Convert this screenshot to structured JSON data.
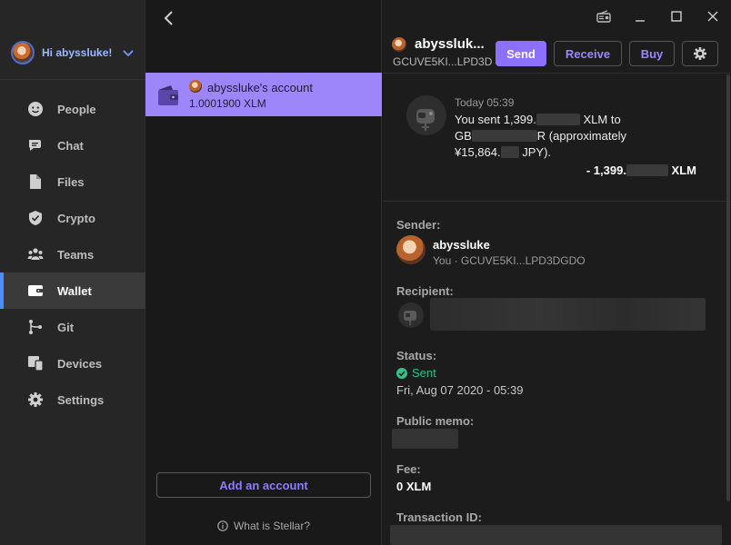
{
  "nav": {
    "greeting": "Hi abyssluke!",
    "items": [
      {
        "label": "People",
        "icon": "people-icon"
      },
      {
        "label": "Chat",
        "icon": "chat-icon"
      },
      {
        "label": "Files",
        "icon": "files-icon"
      },
      {
        "label": "Crypto",
        "icon": "crypto-shield-icon"
      },
      {
        "label": "Teams",
        "icon": "teams-icon"
      },
      {
        "label": "Wallet",
        "icon": "wallet-icon",
        "active": true
      },
      {
        "label": "Git",
        "icon": "git-icon"
      },
      {
        "label": "Devices",
        "icon": "devices-icon"
      },
      {
        "label": "Settings",
        "icon": "gear-icon"
      }
    ]
  },
  "accounts": {
    "selected": {
      "name": "abyssluke's account",
      "balance": "1.0001900 XLM"
    },
    "add_label": "Add an account",
    "help_label": "What is Stellar?"
  },
  "header": {
    "name": "abyssluk...",
    "address": "GCUVE5KI...LPD3D",
    "send_label": "Send",
    "receive_label": "Receive",
    "buy_label": "Buy"
  },
  "transaction": {
    "time": "Today 05:39",
    "desc_part1": "You sent 1,399.",
    "desc_part2": " XLM to",
    "desc_part3": "GB",
    "desc_part4": "R (approximately",
    "desc_part5": "¥15,864.",
    "desc_part6": " JPY).",
    "amount_prefix": "- 1,399.",
    "amount_suffix": " XLM"
  },
  "details": {
    "sender_label": "Sender:",
    "sender_name": "abyssluke",
    "sender_sub": "You · GCUVE5KI...LPD3DGDO",
    "recipient_label": "Recipient:",
    "status_label": "Status:",
    "status_value": "Sent",
    "status_date": "Fri, Aug 07 2020 - 05:39",
    "memo_label": "Public memo:",
    "fee_label": "Fee:",
    "fee_value": "0 XLM",
    "txid_label": "Transaction ID:"
  },
  "colors": {
    "accent": "#8e70ff",
    "active_nav_bar": "#4c8eff",
    "selected_account_bg": "#9c86fa",
    "status_sent": "#35c08a"
  }
}
